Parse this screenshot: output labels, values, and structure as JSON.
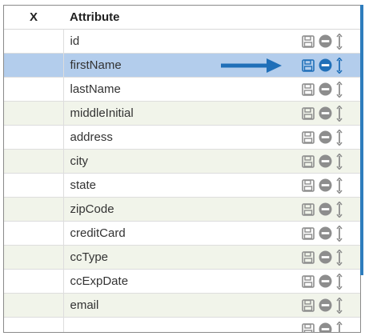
{
  "table": {
    "headers": {
      "x": "X",
      "attribute": "Attribute"
    },
    "rows": [
      {
        "name": "id",
        "selected": false
      },
      {
        "name": "firstName",
        "selected": true
      },
      {
        "name": "lastName",
        "selected": false
      },
      {
        "name": "middleInitial",
        "selected": false
      },
      {
        "name": "address",
        "selected": false
      },
      {
        "name": "city",
        "selected": false
      },
      {
        "name": "state",
        "selected": false
      },
      {
        "name": "zipCode",
        "selected": false
      },
      {
        "name": "creditCard",
        "selected": false
      },
      {
        "name": "ccType",
        "selected": false
      },
      {
        "name": "ccExpDate",
        "selected": false
      },
      {
        "name": "email",
        "selected": false
      },
      {
        "name": "",
        "selected": false
      }
    ]
  },
  "icons": {
    "save": "save-icon",
    "remove": "minus-circle-icon",
    "reorder": "reorder-arrows-icon",
    "pointer": "arrow-right-icon"
  },
  "colors": {
    "icon_gray": "#8d8d8d",
    "icon_blue": "#1f6fb8",
    "selected_row": "#b3cdec",
    "alt_row": "#f1f4ea",
    "scroll_accent": "#2e7dbd"
  }
}
